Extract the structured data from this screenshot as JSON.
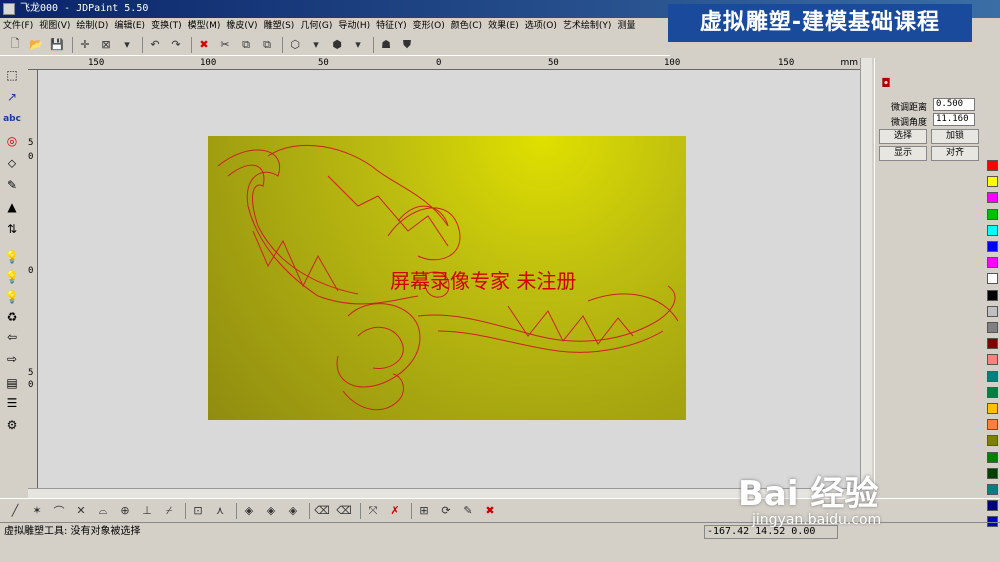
{
  "window": {
    "title": "飞龙000 - JDPaint 5.50"
  },
  "banner": {
    "text": "虚拟雕塑-建模基础课程"
  },
  "menu": [
    "文件(F)",
    "视图(V)",
    "绘制(D)",
    "编辑(E)",
    "变换(T)",
    "模型(M)",
    "橡皮(V)",
    "雕塑(S)",
    "几何(G)",
    "导动(H)",
    "特征(Y)",
    "变形(O)",
    "颜色(C)",
    "效果(E)",
    "选项(O)",
    "艺术绘制(Y)",
    "测量"
  ],
  "toolbar": {
    "icons": [
      "new-file-icon",
      "open-folder-icon",
      "save-icon",
      "crosshair-icon",
      "box-select-icon",
      "dropdown-icon",
      "undo-icon",
      "redo-icon",
      "delete-icon",
      "cut-icon",
      "copy-icon",
      "paste-icon",
      "cube-view-icon",
      "cube-dropdown-icon",
      "shade-icon",
      "shade-dropdown-icon",
      "mask-icon",
      "shield-icon"
    ],
    "glyphs": [
      "🗋",
      "📂",
      "💾",
      "✛",
      "⊠",
      "▾",
      "↶",
      "↷",
      "✖",
      "✂",
      "⧉",
      "⧉",
      "⬡",
      "▾",
      "⬢",
      "▾",
      "☗",
      "⛊"
    ]
  },
  "ruler": {
    "h_labels": [
      "150",
      "100",
      "50",
      "0",
      "50",
      "100",
      "150"
    ],
    "unit": "mm",
    "v_labels": [
      "5",
      "0",
      "0",
      "5",
      "0"
    ]
  },
  "lefttools": {
    "icons": [
      "select-rect-icon",
      "node-edit-icon",
      "text-abc-icon",
      "circle-tool-icon",
      "fill-tool-icon",
      "brush-tool-icon",
      "pointer-icon",
      "mirror-icon",
      "bulb-blue-icon",
      "bulb-green-icon",
      "bulb-gray-icon",
      "rotate-icon",
      "arrow-left-icon",
      "arrow-right-icon",
      "cube-small-icon",
      "list-icon",
      "emboss-icon"
    ],
    "glyphs": [
      "⬚",
      "↗",
      "abc",
      "◎",
      "⬦",
      "✎",
      "▲",
      "⇅",
      "💡",
      "💡",
      "💡",
      "♻",
      "⇦",
      "⇨",
      "▤",
      "☰",
      "⚙"
    ]
  },
  "canvas": {
    "watermark": "屏幕录像专家 未注册"
  },
  "panel": {
    "label_distance": "微调距离",
    "value_distance": "0.500",
    "label_angle": "微调角度",
    "value_angle": "11.160",
    "btn_select": "选择",
    "btn_lock": "加锁",
    "btn_show": "显示",
    "btn_align": "对齐"
  },
  "palette": {
    "colors": [
      "#ff0000",
      "#ffff00",
      "#ff00ff",
      "#00c000",
      "#00ffff",
      "#0000ff",
      "#ff00ff",
      "#ffffff",
      "#000000",
      "#c0c0c0",
      "#808080",
      "#800000",
      "#ff8080",
      "#008080",
      "#008040",
      "#ffc000",
      "#ff8040",
      "#808000",
      "#008000",
      "#004000",
      "#008080",
      "#000080",
      "#0000c0"
    ]
  },
  "bottomtools": {
    "icons": [
      "line-icon",
      "polyline-icon",
      "arc-icon",
      "trim-icon",
      "fillet-icon",
      "circle-node-icon",
      "perpendicular-icon",
      "tangent-icon",
      "snap-point-icon",
      "snap-angle-icon",
      "diamond-grid-icon",
      "diamond-grid2-icon",
      "diamond-grid3-icon",
      "eraser-icon",
      "erase2-icon",
      "cursor-cross-icon",
      "cursor-cancel-icon",
      "grid-edit-icon",
      "rotate-edit-icon",
      "pen-edit-icon",
      "close-red-icon"
    ],
    "glyphs": [
      "╱",
      "✶",
      "⌒",
      "✕",
      "⌓",
      "⊕",
      "⊥",
      "⌿",
      "⊡",
      "⋏",
      "◈",
      "◈",
      "◈",
      "⌫",
      "⌫",
      "⤧",
      "✗",
      "⊞",
      "⟳",
      "✎",
      "✖"
    ]
  },
  "status": {
    "message": "虚拟雕塑工具: 没有对象被选择",
    "coords": "-167.42 14.52 0.00"
  },
  "brand": {
    "logo": "Bai 经验",
    "url": "jingyan.baidu.com"
  }
}
